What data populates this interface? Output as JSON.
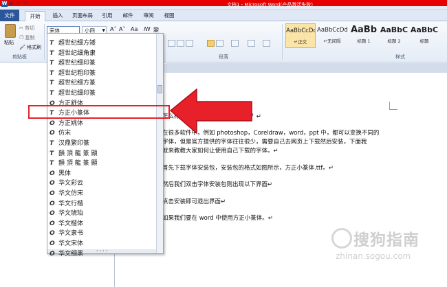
{
  "window": {
    "title": "文档1 - Microsoft Word(产品激活失败)",
    "app_icon": "W"
  },
  "tabs": [
    "文件",
    "开始",
    "插入",
    "页面布局",
    "引用",
    "邮件",
    "审阅",
    "视图"
  ],
  "clipboard": {
    "paste_label": "粘贴",
    "cut_label": "剪切",
    "copy_label": "复制",
    "format_painter_label": "格式刷",
    "group_label": "剪贴板"
  },
  "font": {
    "current_font": "宋体",
    "current_size": "小四",
    "grow_symbol": "A˄",
    "shrink_symbol": "A˅",
    "case_symbol": "Aa",
    "clear_symbol": "ꟿ",
    "phonetic_symbol": "變",
    "border_symbol": "A"
  },
  "paragraph": {
    "group_label": "段落"
  },
  "styles": {
    "group_label": "样式",
    "items": [
      {
        "preview": "AaBbCcDd",
        "name": "↵正文"
      },
      {
        "preview": "AaBbCcDd",
        "name": "↵无间隔"
      },
      {
        "preview": "AaBb",
        "name": "标题 1"
      },
      {
        "preview": "AaBbC",
        "name": "标题 2"
      },
      {
        "preview": "AaBbC",
        "name": "标题"
      },
      {
        "preview": "AaBbC",
        "name": "副标题"
      }
    ]
  },
  "font_list": [
    {
      "glyph": "T",
      "name": "超世纪细方矮"
    },
    {
      "glyph": "T",
      "name": "超世纪细角隶"
    },
    {
      "glyph": "T",
      "name": "超世纪细印篆"
    },
    {
      "glyph": "T",
      "name": "超世纪粗印篆"
    },
    {
      "glyph": "T",
      "name": "超世纪细方篆"
    },
    {
      "glyph": "T",
      "name": "超世纪细印篆"
    },
    {
      "glyph": "O",
      "name": "方正舒体"
    },
    {
      "glyph": "T",
      "name": "方正小篆体"
    },
    {
      "glyph": "O",
      "name": "方正姚体"
    },
    {
      "glyph": "O",
      "name": "仿宋"
    },
    {
      "glyph": "T",
      "name": "汉鼎繁印篆"
    },
    {
      "glyph": "T",
      "name": "韻 頂 龍 篆 顯"
    },
    {
      "glyph": "T",
      "name": "韻 頂 龍 篆 顯"
    },
    {
      "glyph": "O",
      "name": "黑体"
    },
    {
      "glyph": "O",
      "name": "华文彩云"
    },
    {
      "glyph": "O",
      "name": "华文仿宋"
    },
    {
      "glyph": "O",
      "name": "华文行楷"
    },
    {
      "glyph": "O",
      "name": "华文琥珀"
    },
    {
      "glyph": "O",
      "name": "华文楷体"
    },
    {
      "glyph": "O",
      "name": "华文隶书"
    },
    {
      "glyph": "O",
      "name": "华文宋体"
    },
    {
      "glyph": "O",
      "name": "华文细黑"
    }
  ],
  "document": {
    "lines": [
      "怎么样在 word 中使用下载的字体？↵",
      "在很多软件中，例如 photoshop，Coreldraw，word，ppt 中，都可以变换不同的",
      "字体，但是官方提供的字体往往很少，需要自己去网页上下载然后安装，下面我",
      "就来教教大家如何让使用自己下载的字体。↵",
      "首先下载字体安装包，安装包的格式如图所示，方正小篆体.ttf。↵",
      "然后我们双击字体安装包则出现以下界面↵",
      "点击安装即可退出界面↵",
      "如果我们要在 word 中使用方正小篆体。↵"
    ]
  },
  "watermark": {
    "text": "搜狗指南",
    "url": "zhinan.sogou.com"
  },
  "colors": {
    "highlight_box": "#e8202a",
    "arrow": "#e8202a",
    "file_tab": "#2b579a"
  }
}
